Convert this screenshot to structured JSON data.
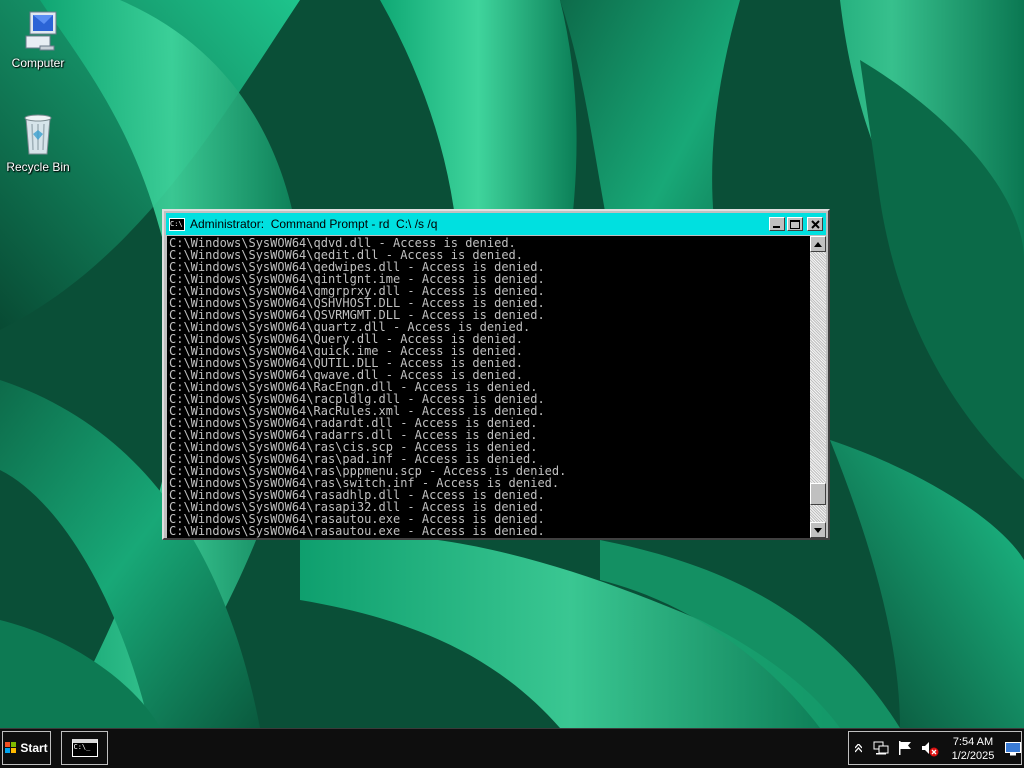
{
  "desktop": {
    "icons": [
      {
        "label": "Computer",
        "icon": "computer-icon"
      },
      {
        "label": "Recycle Bin",
        "icon": "recycle-bin-icon"
      }
    ]
  },
  "window": {
    "title": "Administrator:  Command Prompt - rd  C:\\ /s /q",
    "title_icon_text": "C:\\",
    "buttons": [
      "minimize-icon",
      "maximize-icon",
      "close-icon"
    ],
    "console_lines": [
      "C:\\Windows\\SysWOW64\\qdvd.dll - Access is denied.",
      "C:\\Windows\\SysWOW64\\qedit.dll - Access is denied.",
      "C:\\Windows\\SysWOW64\\qedwipes.dll - Access is denied.",
      "C:\\Windows\\SysWOW64\\qintlgnt.ime - Access is denied.",
      "C:\\Windows\\SysWOW64\\qmgrprxy.dll - Access is denied.",
      "C:\\Windows\\SysWOW64\\QSHVHOST.DLL - Access is denied.",
      "C:\\Windows\\SysWOW64\\QSVRMGMT.DLL - Access is denied.",
      "C:\\Windows\\SysWOW64\\quartz.dll - Access is denied.",
      "C:\\Windows\\SysWOW64\\Query.dll - Access is denied.",
      "C:\\Windows\\SysWOW64\\quick.ime - Access is denied.",
      "C:\\Windows\\SysWOW64\\QUTIL.DLL - Access is denied.",
      "C:\\Windows\\SysWOW64\\qwave.dll - Access is denied.",
      "C:\\Windows\\SysWOW64\\RacEngn.dll - Access is denied.",
      "C:\\Windows\\SysWOW64\\racpldlg.dll - Access is denied.",
      "C:\\Windows\\SysWOW64\\RacRules.xml - Access is denied.",
      "C:\\Windows\\SysWOW64\\radardt.dll - Access is denied.",
      "C:\\Windows\\SysWOW64\\radarrs.dll - Access is denied.",
      "C:\\Windows\\SysWOW64\\ras\\cis.scp - Access is denied.",
      "C:\\Windows\\SysWOW64\\ras\\pad.inf - Access is denied.",
      "C:\\Windows\\SysWOW64\\ras\\pppmenu.scp - Access is denied.",
      "C:\\Windows\\SysWOW64\\ras\\switch.inf - Access is denied.",
      "C:\\Windows\\SysWOW64\\rasadhlp.dll - Access is denied.",
      "C:\\Windows\\SysWOW64\\rasapi32.dll - Access is denied.",
      "C:\\Windows\\SysWOW64\\rasautou.exe - Access is denied.",
      "C:\\Windows\\SysWOW64\\rasautou.exe - Access is denied."
    ],
    "scroll_position": 0.93
  },
  "taskbar": {
    "start_label": "Start",
    "task_icon_text": "C:\\_",
    "tray_icons": [
      "show-hidden-icons-chevron-icon",
      "network-icon",
      "action-center-flag-icon",
      "volume-muted-icon"
    ],
    "time": "7:54 AM",
    "date": "1/2/2025",
    "show_desktop_icon": "monitor-icon"
  },
  "colors": {
    "titlebar": "#00e0e0",
    "console_bg": "#000000",
    "console_text": "#c0c0c0",
    "taskbar_bg": "#0e0e0e"
  }
}
